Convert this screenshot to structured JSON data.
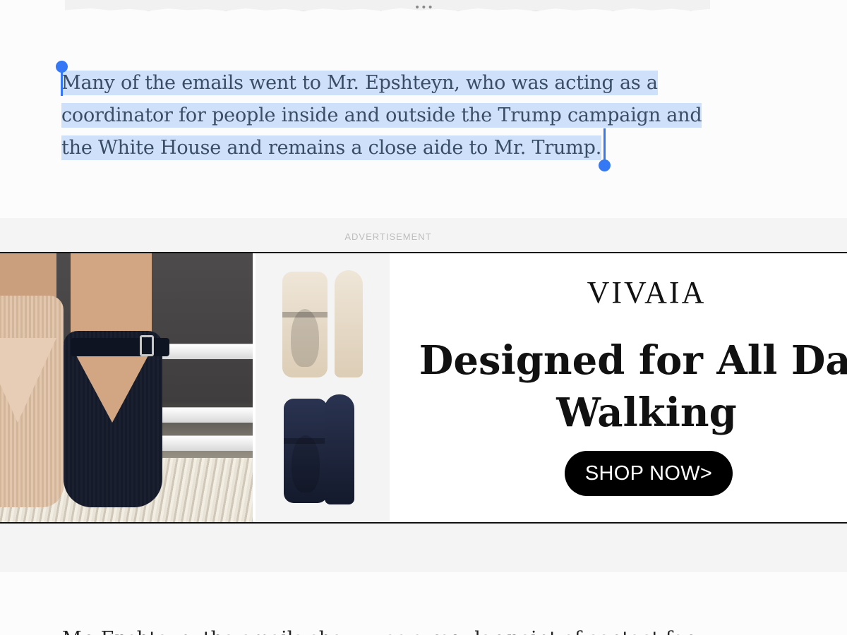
{
  "top_clipping": {
    "more_dots": "•••"
  },
  "article": {
    "selected_paragraph_lines": [
      "Many of the emails went to Mr. Epshteyn, who was acting as a",
      "coordinator for people inside and outside the Trump campaign and",
      "the White House and remains a close aide to Mr. Trump."
    ],
    "next_paragraph_partial": "Mr. Epshteyn, the emails show, was a regular point of contact for"
  },
  "advertisement": {
    "label": "ADVERTISEMENT",
    "brand": "VIVAIA",
    "headline_lines": [
      "Designed for All Day",
      "Walking"
    ],
    "cta_label": "SHOP NOW>"
  },
  "colors": {
    "selection_highlight": "#cfe0fa",
    "selection_handle": "#3478f6",
    "cta_background": "#000000"
  }
}
